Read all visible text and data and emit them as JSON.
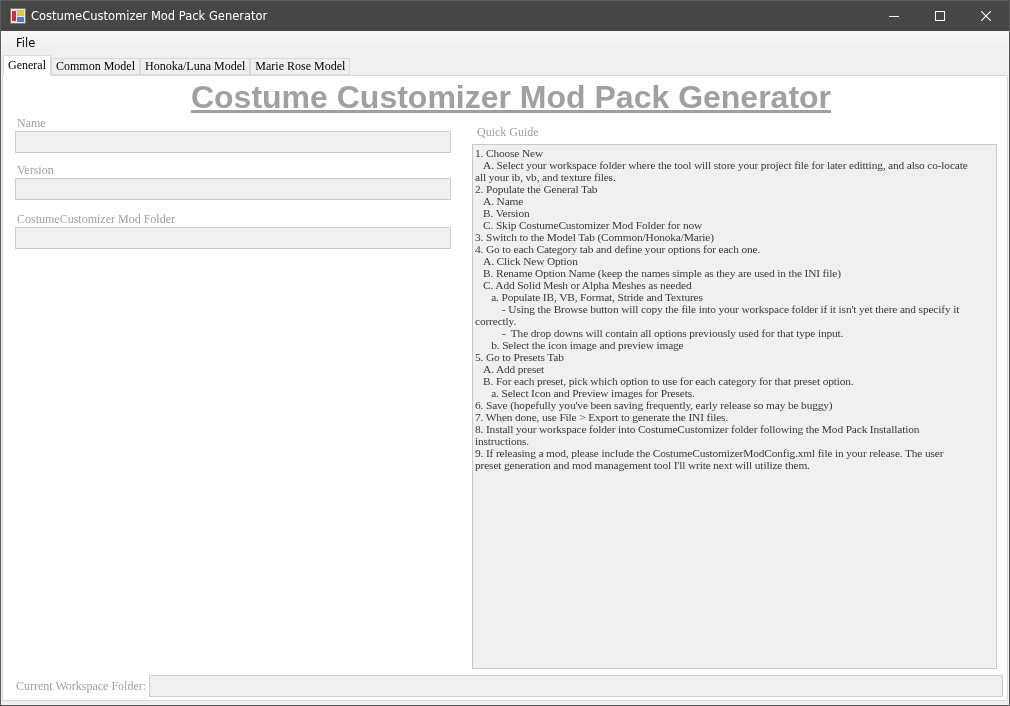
{
  "window": {
    "title": "CostumeCustomizer Mod Pack Generator"
  },
  "menu": [
    {
      "label": "File"
    }
  ],
  "tabs": [
    {
      "label": "General",
      "selected": true
    },
    {
      "label": "Common Model",
      "selected": false
    },
    {
      "label": "Honoka/Luna Model",
      "selected": false
    },
    {
      "label": "Marie Rose Model",
      "selected": false
    }
  ],
  "heading": "Costume Customizer Mod Pack Generator",
  "fields": [
    {
      "label": "Name",
      "disabled": true
    },
    {
      "label": "Version",
      "disabled": true
    },
    {
      "label": "CostumeCustomizer Mod Folder",
      "disabled": true
    }
  ],
  "quick_guide": {
    "label": "Quick Guide",
    "value": "1. Choose New\n   A. Select your workspace folder where the tool will store your project file for later editting, and also co-locate\nall your ib, vb, and texture files.\n2. Populate the General Tab\n   A. Name\n   B. Version\n   C. Skip CostumeCustomizer Mod Folder for now\n3. Switch to the Model Tab (Common/Honoka/Marie)\n4. Go to each Category tab and define your options for each one.\n   A. Click New Option\n   B. Rename Option Name (keep the names simple as they are used in the INI file)\n   C. Add Solid Mesh or Alpha Meshes as needed\n      a. Populate IB, VB, Format, Stride and Textures\n          - Using the Browse button will copy the file into your workspace folder if it isn't yet there and specify it\ncorrectly.\n          -  The drop downs will contain all options previously used for that type input.\n      b. Select the icon image and preview image\n5. Go to Presets Tab\n   A. Add preset\n   B. For each preset, pick which option to use for each category for that preset option.\n      a. Select Icon and Preview images for Presets.\n6. Save (hopefully you've been saving frequently, early release so may be buggy)\n7. When done, use File > Export to generate the INI files.\n8. Install your workspace folder into CostumeCustomizer folder following the Mod Pack Installation\ninstructions.\n9. If releasing a mod, please include the CostumeCustomizerModConfig.xml file in your release. The user\npreset generation and mod management tool I'll write next will utilize them."
  },
  "workspace": {
    "label": "Current Workspace Folder:",
    "disabled": true
  }
}
